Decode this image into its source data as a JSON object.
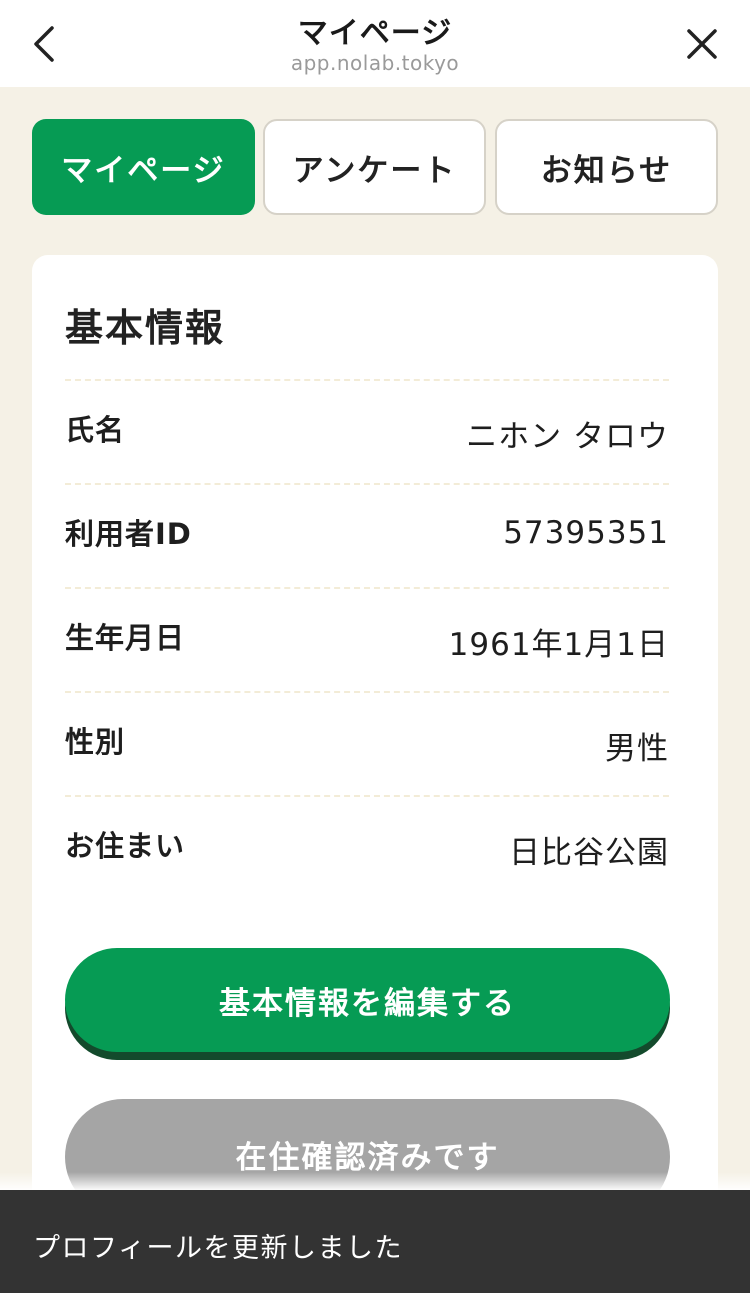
{
  "header": {
    "title": "マイページ",
    "url": "app.nolab.tokyo",
    "back_icon": "chevron-left-icon",
    "close_icon": "close-icon"
  },
  "tabs": [
    {
      "label": "マイページ",
      "active": true
    },
    {
      "label": "アンケート",
      "active": false
    },
    {
      "label": "お知らせ",
      "active": false
    }
  ],
  "profile": {
    "section_title": "基本情報",
    "rows": [
      {
        "label": "氏名",
        "value": "ニホン タロウ"
      },
      {
        "label": "利用者ID",
        "value": "57395351"
      },
      {
        "label": "生年月日",
        "value": "1961年1月1日"
      },
      {
        "label": "性別",
        "value": "男性"
      },
      {
        "label": "お住まい",
        "value": "日比谷公園"
      }
    ],
    "edit_button": "基本情報を編集する",
    "residence_button": "在住確認済みです"
  },
  "toast": {
    "message": "プロフィールを更新しました"
  },
  "colors": {
    "accent": "#069b54",
    "background": "#f5f1e6",
    "disabled": "#a5a5a5",
    "toast": "#333333"
  }
}
